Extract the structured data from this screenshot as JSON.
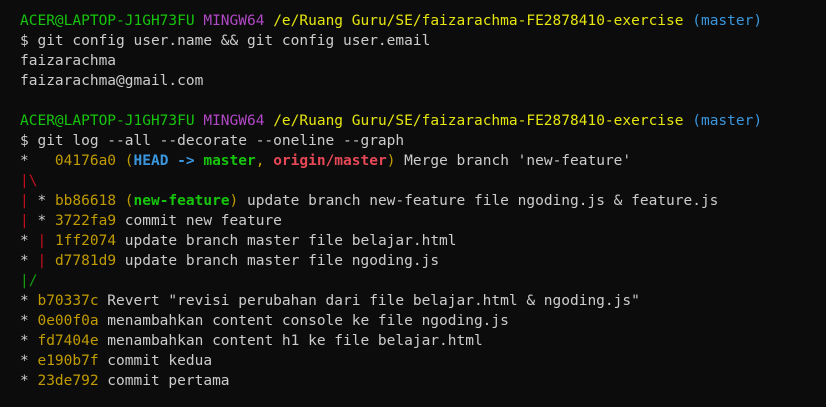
{
  "prompt1": {
    "user_host": "ACER@LAPTOP-J1GH73FU",
    "shell": "MINGW64",
    "path": "/e/Ruang Guru/SE/faizarachma-FE2878410-exercise",
    "branch": "(master)"
  },
  "command1": "$ git config user.name && git config user.email",
  "output1": [
    "faizarachma",
    "faizarachma@gmail.com"
  ],
  "prompt2": {
    "user_host": "ACER@LAPTOP-J1GH73FU",
    "shell": "MINGW64",
    "path": "/e/Ruang Guru/SE/faizarachma-FE2878410-exercise",
    "branch": "(master)"
  },
  "command2": "$ git log --all --decorate --oneline --graph",
  "log": {
    "l1": {
      "graph": "*   ",
      "hash": "04176a0",
      "open": " (",
      "head": "HEAD -> ",
      "master": "master",
      "sep": ", ",
      "origin": "origin/master",
      "close": ")",
      "msg": " Merge branch 'new-feature'"
    },
    "l2": {
      "g1": "|",
      "g2": "\\"
    },
    "l3": {
      "g1": "|",
      "g2": " * ",
      "hash": "bb86618",
      "open": " (",
      "ref": "new-feature",
      "close": ")",
      "msg": " update branch new-feature file ngoding.js & feature.js"
    },
    "l4": {
      "g1": "|",
      "g2": " * ",
      "hash": "3722fa9",
      "msg": " commit new feature"
    },
    "l5": {
      "g1": "* ",
      "g2": "|",
      "g3": " ",
      "hash": "1ff2074",
      "msg": " update branch master file belajar.html"
    },
    "l6": {
      "g1": "* ",
      "g2": "|",
      "g3": " ",
      "hash": "d7781d9",
      "msg": " update branch master file ngoding.js"
    },
    "l7": {
      "g1": "|",
      "g2": "/"
    },
    "l8": {
      "graph": "* ",
      "hash": "b70337c",
      "msg": " Revert \"revisi perubahan dari file belajar.html & ngoding.js\""
    },
    "l9": {
      "graph": "* ",
      "hash": "0e00f0a",
      "msg": " menambahkan content console ke file ngoding.js"
    },
    "l10": {
      "graph": "* ",
      "hash": "fd7404e",
      "msg": " menambahkan content h1 ke file belajar.html"
    },
    "l11": {
      "graph": "* ",
      "hash": "e190b7f",
      "msg": " commit kedua"
    },
    "l12": {
      "graph": "* ",
      "hash": "23de792",
      "msg": " commit pertama"
    }
  }
}
